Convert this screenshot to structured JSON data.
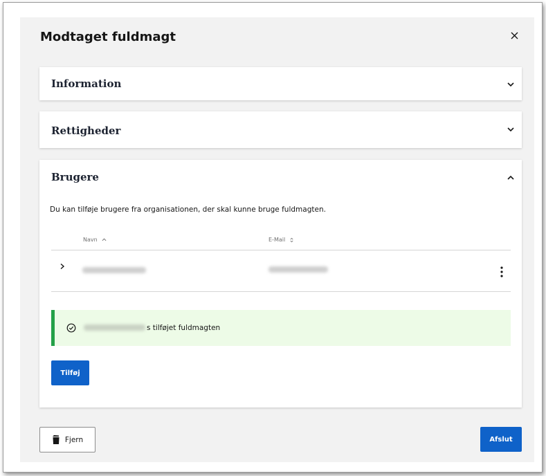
{
  "modal": {
    "title": "Modtaget fuldmagt",
    "close_icon": "close-icon"
  },
  "sections": {
    "information": {
      "title": "Information",
      "state": "collapsed"
    },
    "rettigheder": {
      "title": "Rettigheder",
      "state": "collapsed"
    },
    "brugere": {
      "title": "Brugere",
      "state": "expanded",
      "description": "Du kan tilføje brugere fra organisationen, der skal kunne bruge fuldmagten.",
      "table": {
        "columns": [
          "Navn",
          "E-Mail"
        ],
        "sort_icons": [
          "sort-ascending-icon",
          "sort-neutral-icon"
        ]
      },
      "notification": {
        "kind": "success",
        "text": "s tilføjet fuldmagten",
        "icon": "checkmark-circle-icon"
      },
      "add_button": "Tilføj"
    }
  },
  "footer": {
    "remove_button": "Fjern",
    "remove_icon": "trash-icon",
    "finish_button": "Afslut"
  },
  "colors": {
    "primary": "#0f62c9",
    "success": "#24a148",
    "success_bg": "#edfbe7",
    "modal_bg": "#f2f2f2"
  }
}
